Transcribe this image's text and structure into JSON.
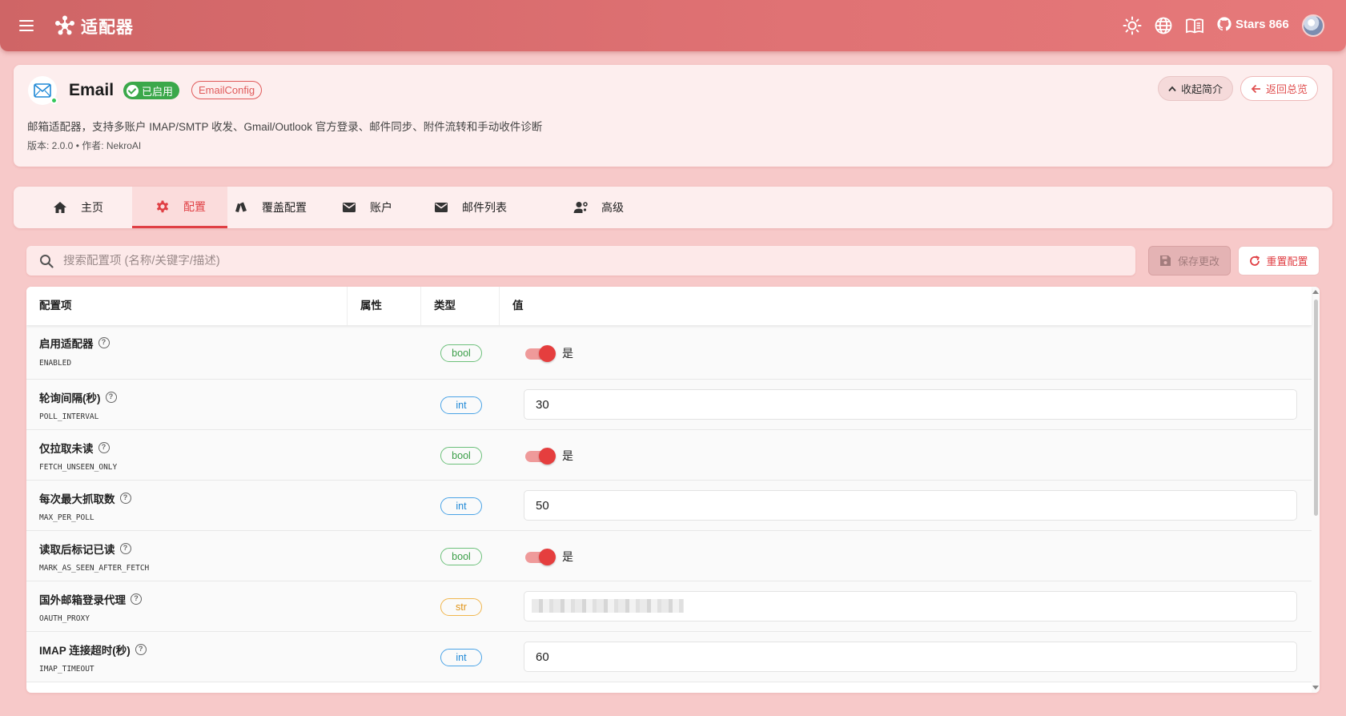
{
  "appbar": {
    "title": "适配器",
    "stars_label": "Stars 866",
    "icons": [
      "menu-icon",
      "adapter-logo-icon",
      "theme-sun-icon",
      "language-globe-icon",
      "docs-book-icon",
      "github-icon",
      "avatar"
    ]
  },
  "adapter": {
    "name": "Email",
    "status": "已启用",
    "config_class": "EmailConfig",
    "description": "邮箱适配器，支持多账户 IMAP/SMTP 收发、Gmail/Outlook 官方登录、邮件同步、附件流转和手动收件诊断",
    "meta": "版本: 2.0.0 • 作者: NekroAI",
    "collapse_label": "收起简介",
    "back_label": "返回总览"
  },
  "tabs": [
    {
      "label": "主页",
      "icon": "home-icon"
    },
    {
      "label": "配置",
      "icon": "gear-icon",
      "active": true
    },
    {
      "label": "覆盖配置",
      "icon": "cards-icon"
    },
    {
      "label": "账户",
      "icon": "mail-icon"
    },
    {
      "label": "邮件列表",
      "icon": "mail-list-icon"
    },
    {
      "label": "高级",
      "icon": "user-settings-icon"
    }
  ],
  "search": {
    "placeholder": "搜索配置项 (名称/关键字/描述)",
    "value": ""
  },
  "actions": {
    "save_label": "保存更改",
    "reset_label": "重置配置"
  },
  "table": {
    "headers": [
      "配置项",
      "属性",
      "类型",
      "值"
    ],
    "rows": [
      {
        "title": "启用适配器",
        "key": "ENABLED",
        "type": "bool",
        "value": "是"
      },
      {
        "title": "轮询间隔(秒)",
        "key": "POLL_INTERVAL",
        "type": "int",
        "value": "30"
      },
      {
        "title": "仅拉取未读",
        "key": "FETCH_UNSEEN_ONLY",
        "type": "bool",
        "value": "是"
      },
      {
        "title": "每次最大抓取数",
        "key": "MAX_PER_POLL",
        "type": "int",
        "value": "50"
      },
      {
        "title": "读取后标记已读",
        "key": "MARK_AS_SEEN_AFTER_FETCH",
        "type": "bool",
        "value": "是"
      },
      {
        "title": "国外邮箱登录代理",
        "key": "OAUTH_PROXY",
        "type": "str",
        "value": ""
      },
      {
        "title": "IMAP 连接超时(秒)",
        "key": "IMAP_TIMEOUT",
        "type": "int",
        "value": "60"
      }
    ]
  },
  "colors": {
    "appbar": "#d96a6b",
    "accent": "#e03f44",
    "page_bg": "#f7c9c9",
    "status_green": "#3ba84a",
    "bool_chip": "#3b9e48",
    "int_chip": "#1e88d6",
    "str_chip": "#e09418"
  }
}
